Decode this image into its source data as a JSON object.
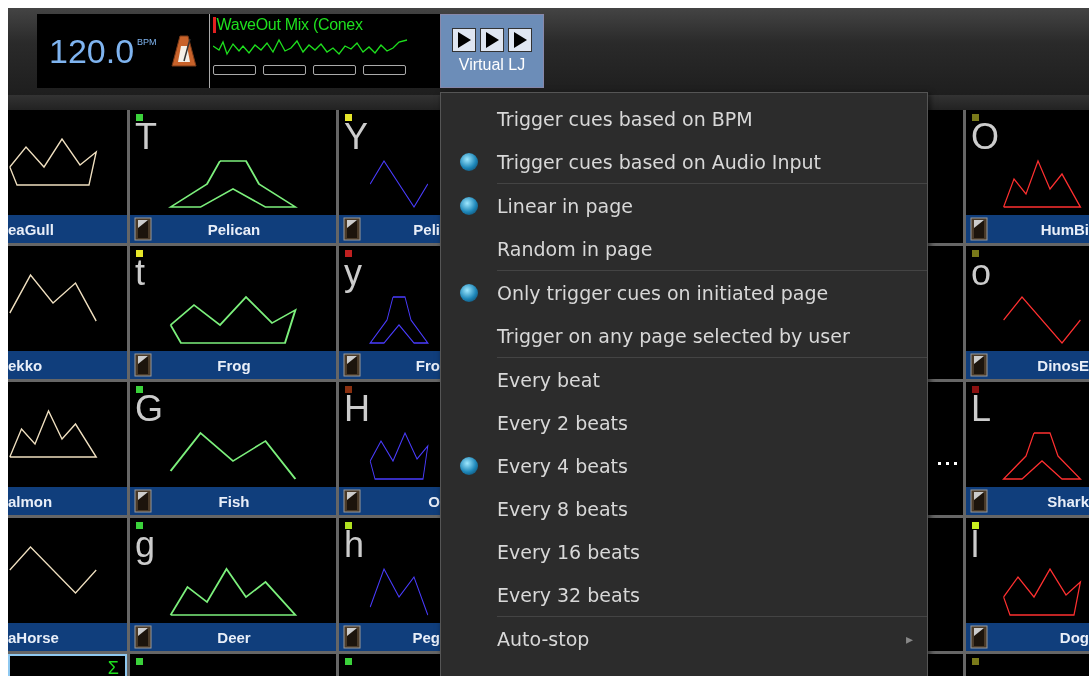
{
  "toolbar": {
    "bpm": "120.0",
    "bpm_unit": "BPM",
    "audio_source": "WaveOut Mix (Conex",
    "button_label": "Virtual LJ"
  },
  "grid": {
    "rows": [
      {
        "cells": [
          {
            "name": "eaGull",
            "selected": false
          },
          {
            "key": "T",
            "name": "Pelican",
            "color": "#3bd23b",
            "selected": false
          },
          {
            "key": "Y",
            "name": "Peli",
            "color": "#e6e62a",
            "selected": false
          },
          {
            "key": "O",
            "name": "HumBi",
            "color": "#7a7a1a",
            "selected": false
          }
        ]
      },
      {
        "cells": [
          {
            "name": "ekko",
            "selected": false
          },
          {
            "key": "t",
            "name": "Frog",
            "color": "#e6e62a",
            "selected": false
          },
          {
            "key": "y",
            "name": "Fro",
            "color": "#c02020",
            "selected": false
          },
          {
            "key": "o",
            "name": "DinosE",
            "color": "#7a7a1a",
            "selected": false
          }
        ]
      },
      {
        "cells": [
          {
            "name": "almon",
            "selected": false
          },
          {
            "key": "G",
            "name": "Fish",
            "color": "#3bd23b",
            "selected": false
          },
          {
            "key": "H",
            "name": "O",
            "color": "#8a3010",
            "selected": false
          },
          {
            "key": "L",
            "name": "Shark",
            "color": "#8a1010",
            "selected": false
          }
        ]
      },
      {
        "cells": [
          {
            "name": "aHorse",
            "selected": false
          },
          {
            "key": "g",
            "name": "Deer",
            "color": "#3bd23b",
            "selected": false
          },
          {
            "key": "h",
            "name": "Peg",
            "color": "#b0e020",
            "selected": false
          },
          {
            "key": "l",
            "name": "Dog",
            "color": "#c8f020",
            "selected": false
          }
        ]
      },
      {
        "cells": [
          {
            "key": "Σ",
            "selected": true
          },
          {
            "color": "#3bd23b",
            "selected": false
          },
          {
            "color": "#3bd23b",
            "selected": false
          },
          {
            "color": "#7a7a1a",
            "selected": false
          }
        ]
      }
    ]
  },
  "menu": {
    "items": [
      {
        "kind": "radio",
        "label": "Trigger cues based on BPM",
        "checked": false
      },
      {
        "kind": "radio",
        "label": "Trigger cues based on Audio Input",
        "checked": true
      },
      {
        "kind": "separator"
      },
      {
        "kind": "radio",
        "label": "Linear in page",
        "checked": true
      },
      {
        "kind": "radio",
        "label": "Random in page",
        "checked": false
      },
      {
        "kind": "separator"
      },
      {
        "kind": "radio",
        "label": "Only trigger cues on initiated page",
        "checked": true
      },
      {
        "kind": "radio",
        "label": "Trigger on any page selected by user",
        "checked": false
      },
      {
        "kind": "separator"
      },
      {
        "kind": "radio",
        "label": "Every beat",
        "checked": false
      },
      {
        "kind": "radio",
        "label": "Every 2 beats",
        "checked": false
      },
      {
        "kind": "radio",
        "label": "Every 4 beats",
        "checked": true
      },
      {
        "kind": "radio",
        "label": "Every 8 beats",
        "checked": false
      },
      {
        "kind": "radio",
        "label": "Every 16 beats",
        "checked": false
      },
      {
        "kind": "radio",
        "label": "Every 32 beats",
        "checked": false
      },
      {
        "kind": "separator"
      },
      {
        "kind": "submenu",
        "label": "Auto-stop",
        "arrow": "▸"
      }
    ]
  }
}
